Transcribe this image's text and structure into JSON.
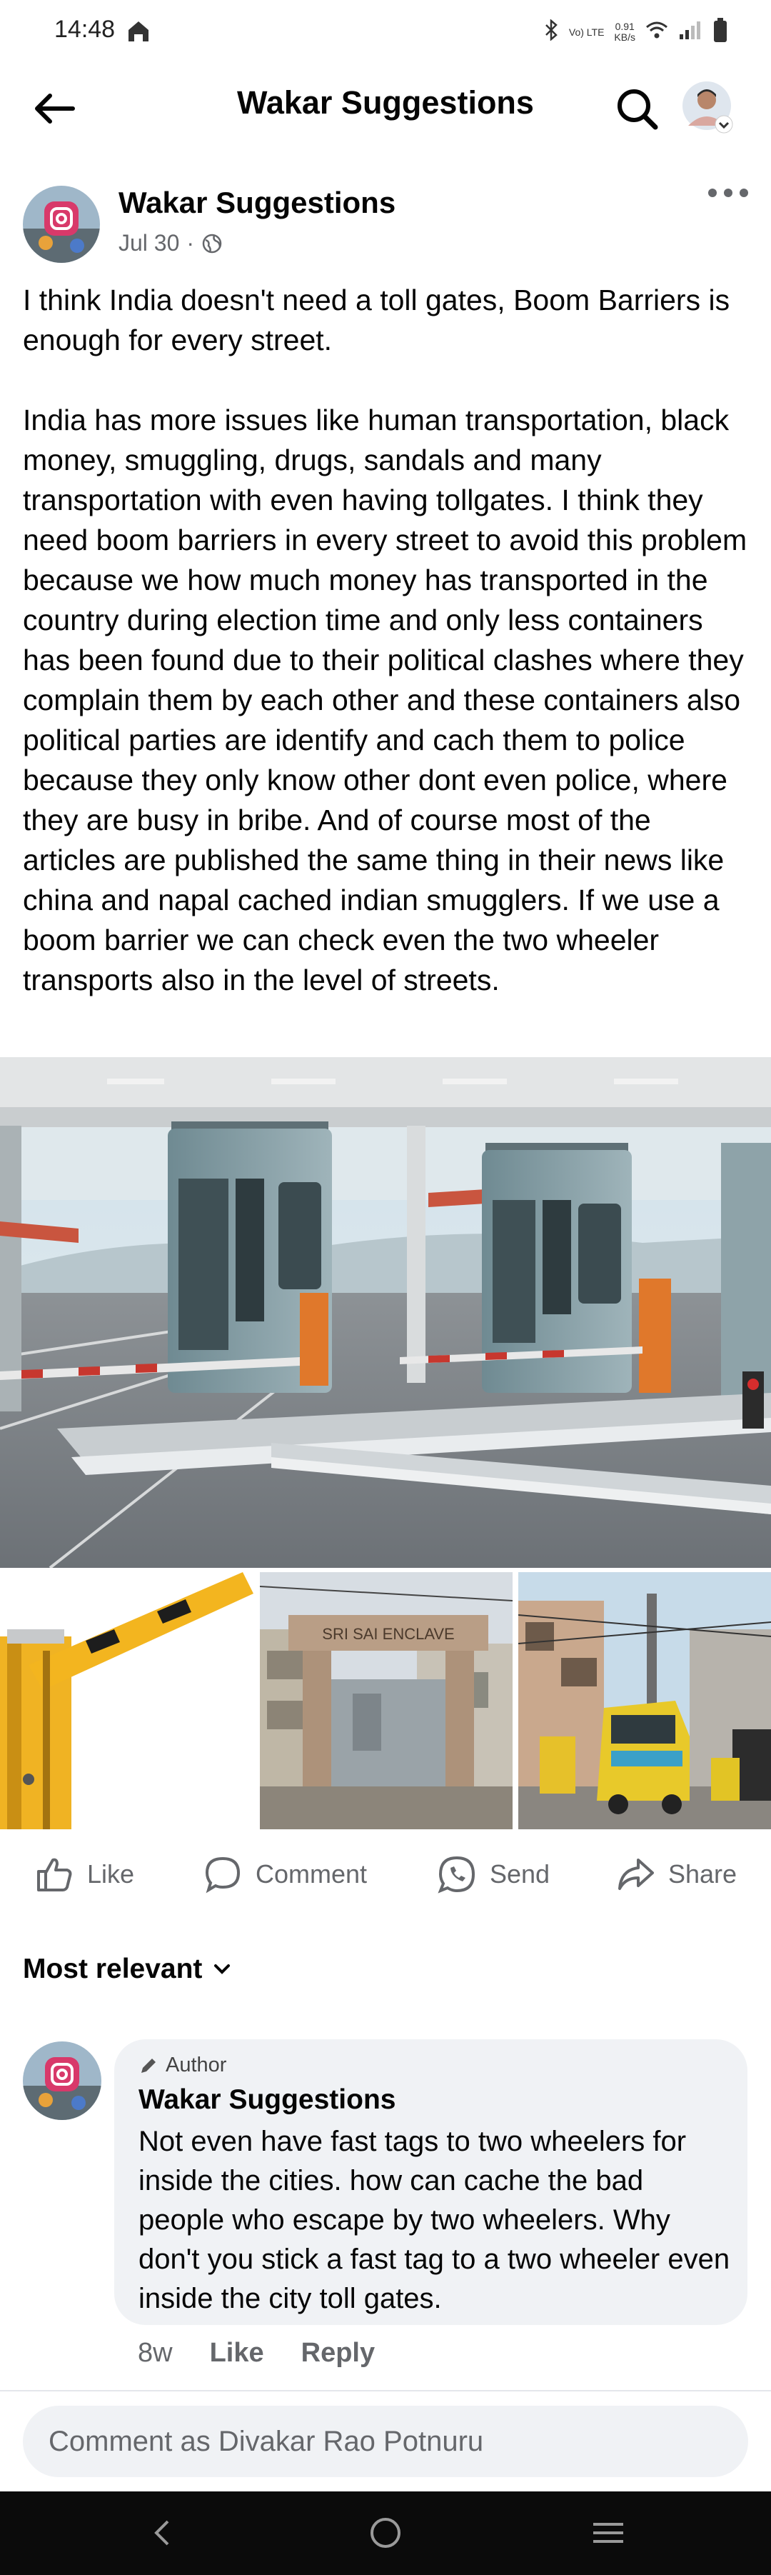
{
  "status_bar": {
    "time": "14:48",
    "network_speed": "0.91",
    "network_unit": "KB/s",
    "network_label": "Vo) LTE"
  },
  "header": {
    "title": "Wakar Suggestions"
  },
  "post": {
    "author": "Wakar Suggestions",
    "date": "Jul 30",
    "text": "I think India doesn't need a toll gates, Boom Barriers is enough for every street.\n\nIndia has more issues like human transportation, black money, smuggling, drugs, sandals and many transportation with even having tollgates. I think they need boom barriers in every street to avoid this problem because we how much money has transported in the country during election time and only less containers has been found due to their political clashes where they complain them by each other and these containers also political parties are identify and cach them to police because they only know other dont even police, where they are busy in bribe. And of course most of the articles are published the same thing in their news like china and napal cached indian smugglers. If we use a boom barrier we can check even the two wheeler transports also in the level of streets.",
    "gate_sign": "SRI SAI ENCLAVE"
  },
  "actions": {
    "like": "Like",
    "comment": "Comment",
    "send": "Send",
    "share": "Share"
  },
  "comments": {
    "sort_label": "Most relevant",
    "items": [
      {
        "badge": "Author",
        "author": "Wakar Suggestions",
        "text": "Not even have fast tags to two wheelers for inside the cities. how can cache the bad people who escape by two wheelers. Why don't you stick a fast tag to a two wheeler even inside the city toll gates.",
        "time": "8w",
        "like": "Like",
        "reply": "Reply"
      }
    ]
  },
  "composer": {
    "placeholder": "Comment as Divakar Rao Potnuru"
  },
  "colors": {
    "text": "#050505",
    "secondary": "#65676b",
    "bubble": "#f0f2f5",
    "nav": "#0b0b0b"
  }
}
